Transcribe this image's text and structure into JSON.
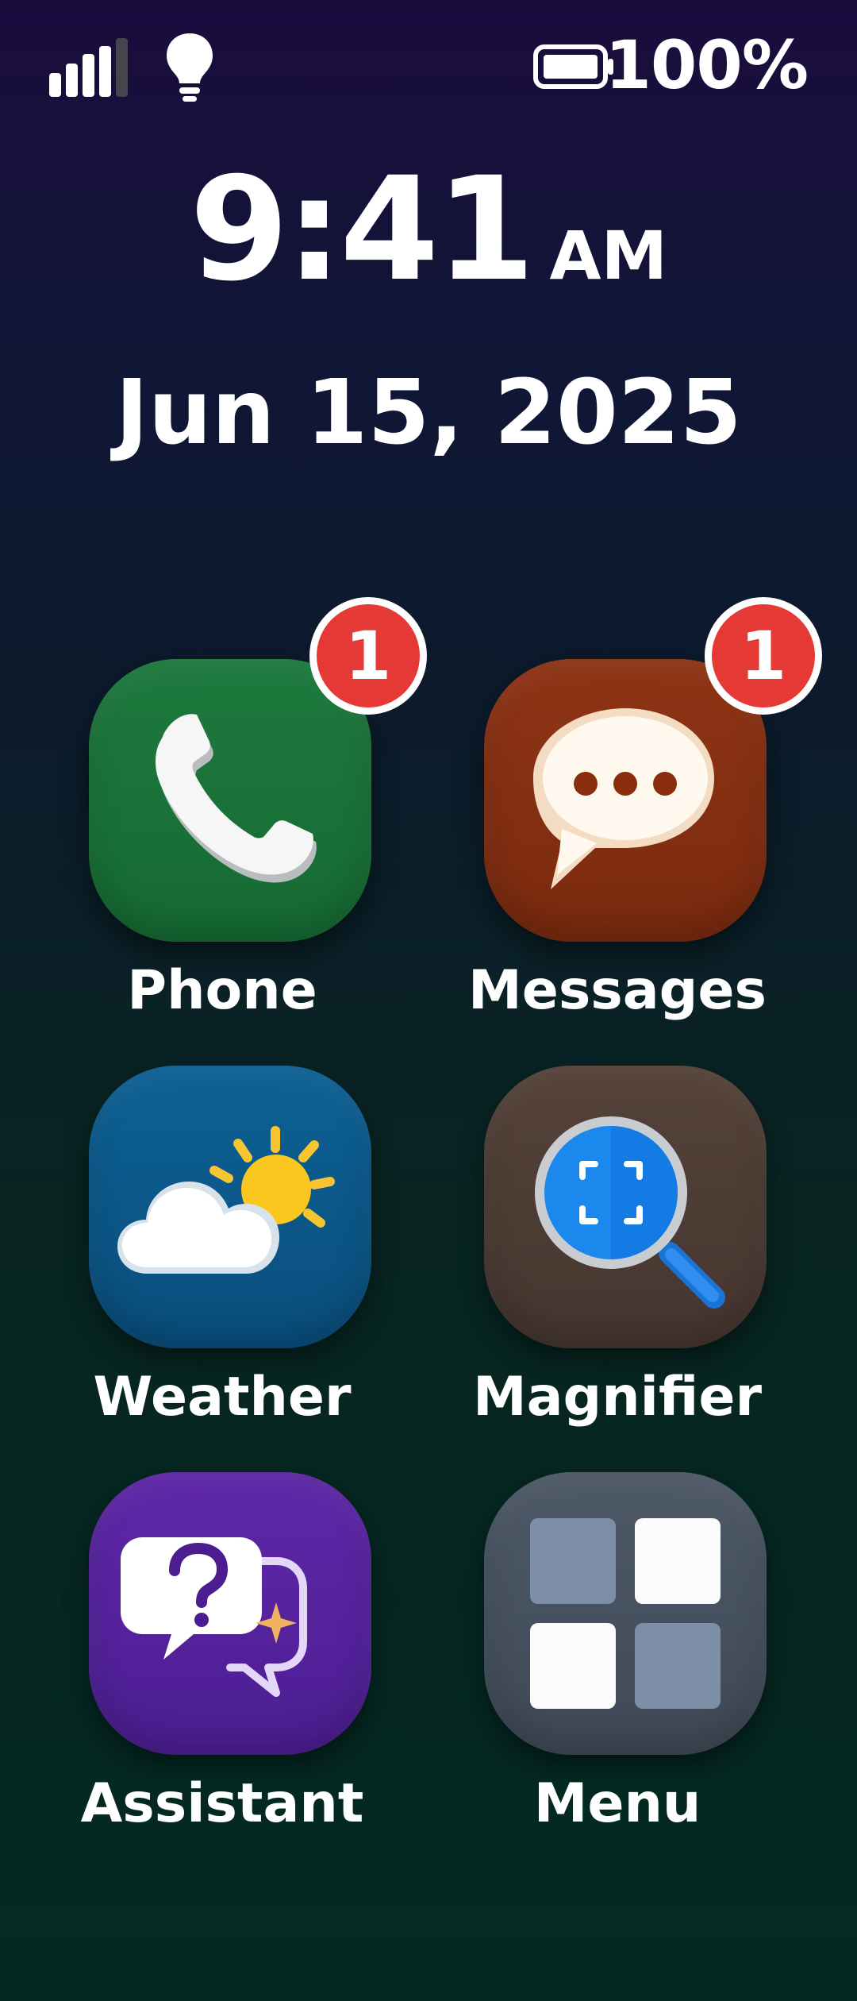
{
  "status_bar": {
    "signal_icon": "signal-icon",
    "signal_level": 4,
    "signal_max": 5,
    "flashlight_icon": "lightbulb-icon",
    "battery_icon": "battery-icon",
    "battery_text": "100%",
    "battery_level": 1.0
  },
  "clock": {
    "time": "9:41",
    "ampm": "AM",
    "date": "Jun 15, 2025"
  },
  "apps": [
    {
      "id": "phone",
      "label": "Phone",
      "icon": "phone-icon",
      "badge": "1",
      "color": "#1e7a3e"
    },
    {
      "id": "messages",
      "label": "Messages",
      "icon": "chat-bubble-icon",
      "badge": "1",
      "color": "#8f3415"
    },
    {
      "id": "weather",
      "label": "Weather",
      "icon": "partly-cloudy-icon",
      "color": "#0d6196"
    },
    {
      "id": "magnifier",
      "label": "Magnifier",
      "icon": "magnifier-icon",
      "color": "#55433a"
    },
    {
      "id": "assistant",
      "label": "Assistant",
      "icon": "assistant-question-icon",
      "color": "#5f27a8"
    },
    {
      "id": "menu",
      "label": "Menu",
      "icon": "grid-menu-icon",
      "color": "#4e5968"
    }
  ],
  "colors": {
    "badge": "#e53935",
    "background_top": "#1b0c3e",
    "background_bottom": "#032a22"
  }
}
